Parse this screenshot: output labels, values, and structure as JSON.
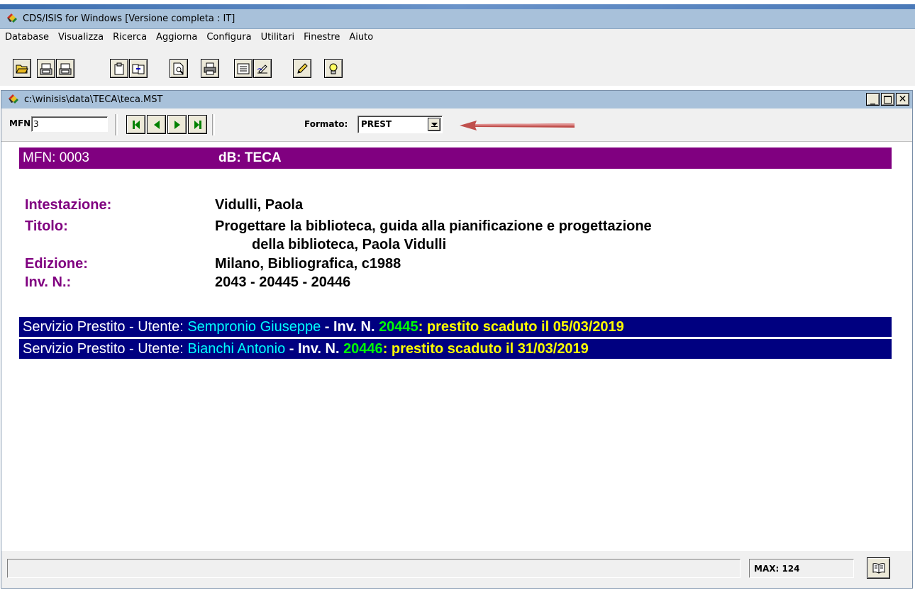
{
  "app": {
    "title": "CDS/ISIS for Windows [Versione completa : IT]",
    "icon": "isis-logo-icon"
  },
  "menu": [
    "Database",
    "Visualizza",
    "Ricerca",
    "Aggiorna",
    "Configura",
    "Utilitari",
    "Finestre",
    "Aiuto"
  ],
  "toolbar": {
    "icons": [
      "open-folder-icon",
      "export-txt-icon",
      "export-rtf-icon",
      "clipboard-icon",
      "copy-record-icon",
      "print-preview-icon",
      "print-icon",
      "form-icon",
      "edit-entry-icon",
      "pencil-icon",
      "lightbulb-icon"
    ]
  },
  "child": {
    "title": "c:\\winisis\\data\\TECA\\teca.MST",
    "mfn_label": "MFN",
    "mfn_value": "3",
    "format_label": "Formato:",
    "format_value": "PREST"
  },
  "record": {
    "mfn": "MFN: 0003",
    "db": "dB: TECA",
    "fields": [
      {
        "label": "Intestazione:",
        "value": "Vidulli, Paola"
      },
      {
        "label": "Titolo:",
        "value": "Progettare la biblioteca, guida alla pianificazione e progettazione",
        "value2": "della biblioteca, Paola Vidulli"
      },
      {
        "label": "Edizione:",
        "value": "Milano, Bibliografica, c1988"
      },
      {
        "label": "Inv. N.:",
        "value": "2043 - 20445 - 20446"
      }
    ],
    "loans": [
      {
        "prefix": "Servizio Prestito - Utente: ",
        "user": "Sempronio Giuseppe",
        "inv_label": " - Inv. N. ",
        "inv": "20445",
        "status": ": prestito scaduto il 05/03/2019"
      },
      {
        "prefix": "Servizio Prestito - Utente: ",
        "user": "Bianchi Antonio",
        "inv_label": " - Inv. N. ",
        "inv": "20446",
        "status": ": prestito scaduto il 31/03/2019"
      }
    ]
  },
  "status": {
    "max": "MAX: 124"
  },
  "colors": {
    "header_bg": "#800080",
    "label": "#800080",
    "loan_bg": "#000080",
    "user": "#00ffff",
    "inv": "#00ff00",
    "status": "#ffff00",
    "annotation_arrow": "#c0504d"
  }
}
